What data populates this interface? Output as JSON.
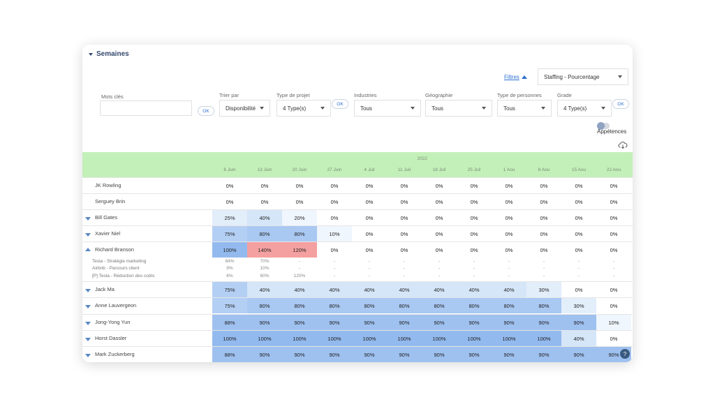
{
  "section": {
    "title": "Semaines"
  },
  "filters": {
    "toggle_link": "Filtres",
    "view_select": "Staffing - Pourcentage",
    "keywords": {
      "label": "Mots clés",
      "value": "",
      "ok": "OK"
    },
    "sort": {
      "label": "Trier par",
      "value": "Disponibilité"
    },
    "project_type": {
      "label": "Type de projet",
      "value": "4 Type(s)",
      "ok": "OK"
    },
    "industries": {
      "label": "Industries",
      "value": "Tous"
    },
    "geography": {
      "label": "Géographie",
      "value": "Tous"
    },
    "person_type": {
      "label": "Type de personnes",
      "value": "Tous"
    },
    "grade": {
      "label": "Grade",
      "value": "4 Type(s)",
      "ok": "OK"
    },
    "appetences": {
      "label": "Appétences",
      "on": false
    }
  },
  "colors": {
    "header_bg": "#c3f0b8",
    "over_alloc": "#f5a0a0",
    "accent": "#2c6fd1"
  },
  "table": {
    "year": "2022",
    "weeks": [
      "6 Juin",
      "13 Juin",
      "20 Juin",
      "27 Juin",
      "4 Juil",
      "11 Juil",
      "18 Juil",
      "25 Juil",
      "1 Aou",
      "8 Aou",
      "15 Aou",
      "22 Aou"
    ],
    "rows": [
      {
        "name": "JK Rowling",
        "expand": "none",
        "values": [
          "0%",
          "0%",
          "0%",
          "0%",
          "0%",
          "0%",
          "0%",
          "0%",
          "0%",
          "0%",
          "0%",
          "0%"
        ]
      },
      {
        "name": "Serguey Brin",
        "expand": "none",
        "values": [
          "0%",
          "0%",
          "0%",
          "0%",
          "0%",
          "0%",
          "0%",
          "0%",
          "0%",
          "0%",
          "0%",
          "0%"
        ]
      },
      {
        "name": "Bill Gates",
        "expand": "down",
        "values": [
          "25%",
          "40%",
          "20%",
          "0%",
          "0%",
          "0%",
          "0%",
          "0%",
          "0%",
          "0%",
          "0%",
          "0%"
        ]
      },
      {
        "name": "Xavier Niel",
        "expand": "down",
        "values": [
          "75%",
          "80%",
          "80%",
          "10%",
          "0%",
          "0%",
          "0%",
          "0%",
          "0%",
          "0%",
          "0%",
          "0%"
        ]
      },
      {
        "name": "Richard Branson",
        "expand": "up",
        "values": [
          "100%",
          "140%",
          "120%",
          "0%",
          "0%",
          "0%",
          "0%",
          "0%",
          "0%",
          "0%",
          "0%",
          "0%"
        ]
      },
      {
        "name": "Jack Ma",
        "expand": "down",
        "values": [
          "75%",
          "40%",
          "40%",
          "40%",
          "40%",
          "40%",
          "40%",
          "40%",
          "40%",
          "30%",
          "0%",
          "0%"
        ]
      },
      {
        "name": "Anne Lauvergeon",
        "expand": "down",
        "values": [
          "75%",
          "80%",
          "80%",
          "80%",
          "80%",
          "80%",
          "80%",
          "80%",
          "80%",
          "80%",
          "30%",
          "0%"
        ]
      },
      {
        "name": "Jong-Yong Yun",
        "expand": "down",
        "values": [
          "88%",
          "90%",
          "90%",
          "90%",
          "90%",
          "90%",
          "90%",
          "90%",
          "90%",
          "90%",
          "90%",
          "10%"
        ]
      },
      {
        "name": "Horst Dassler",
        "expand": "down",
        "values": [
          "100%",
          "100%",
          "100%",
          "100%",
          "100%",
          "100%",
          "100%",
          "100%",
          "100%",
          "100%",
          "40%",
          "0%"
        ]
      },
      {
        "name": "Mark Zuckerberg",
        "expand": "down",
        "values": [
          "88%",
          "90%",
          "90%",
          "90%",
          "90%",
          "90%",
          "90%",
          "90%",
          "90%",
          "90%",
          "90%",
          "90%"
        ]
      }
    ],
    "subrows": [
      {
        "name": "Tesla - Stratégie marketing",
        "values": [
          "84%",
          "70%",
          "-",
          "-",
          "-",
          "-",
          "-",
          "-",
          "-",
          "-",
          "-",
          "-"
        ]
      },
      {
        "name": "Airbnb - Parcours client",
        "values": [
          "9%",
          "10%",
          "-",
          "-",
          "-",
          "-",
          "-",
          "-",
          "-",
          "-",
          "-",
          "-"
        ]
      },
      {
        "name": "[P] Tesla - Réduction des coûts",
        "values": [
          "6%",
          "60%",
          "120%",
          "-",
          "-",
          "-",
          "-",
          "-",
          "-",
          "-",
          "-",
          "-"
        ]
      }
    ]
  },
  "help_icon": "?"
}
